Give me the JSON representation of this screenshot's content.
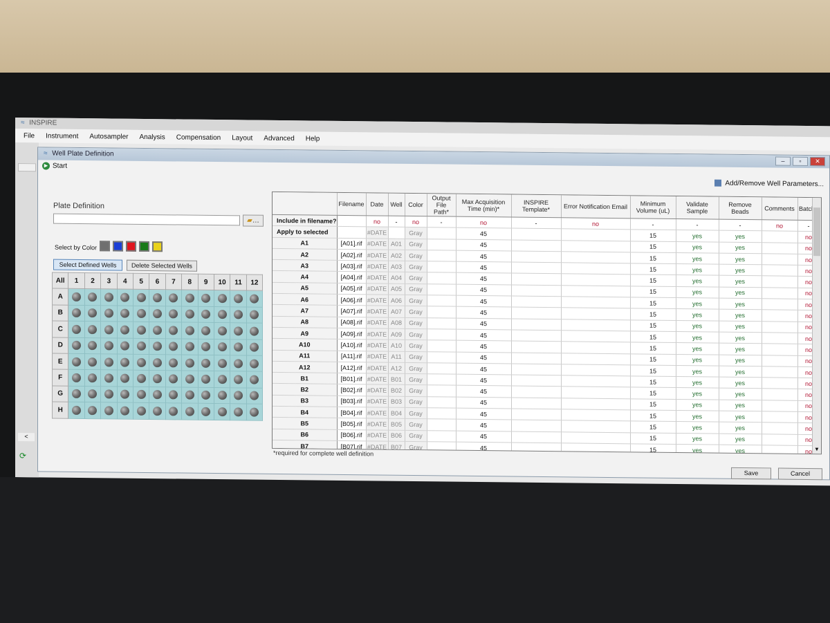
{
  "app": {
    "title": "INSPIRE",
    "menu": [
      "File",
      "Instrument",
      "Autosampler",
      "Analysis",
      "Compensation",
      "Layout",
      "Advanced",
      "Help"
    ]
  },
  "dialog": {
    "title": "Well Plate Definition",
    "start_label": "Start",
    "add_remove_label": "Add/Remove Well Parameters...",
    "plate_definition_label": "Plate Definition",
    "plate_definition_value": "",
    "folder_button": "…",
    "select_by_color_label": "Select by Color",
    "colors": [
      "#6f6f6f",
      "#1b3fd6",
      "#e0141e",
      "#1a7a1a",
      "#e9d21b"
    ],
    "select_defined_wells": "Select Defined Wells",
    "delete_selected_wells": "Delete Selected Wells",
    "save_label": "Save",
    "cancel_label": "Cancel",
    "footnote": "*required for complete well definition"
  },
  "plate": {
    "all_label": "All",
    "columns": [
      "1",
      "2",
      "3",
      "4",
      "5",
      "6",
      "7",
      "8",
      "9",
      "10",
      "11",
      "12"
    ],
    "rows": [
      "A",
      "B",
      "C",
      "D",
      "E",
      "F",
      "G",
      "H"
    ]
  },
  "grid": {
    "headers": [
      "",
      "Filename",
      "Date",
      "Well",
      "Color",
      "Output File Path*",
      "Max Acquisition Time (min)*",
      "INSPIRE Template*",
      "Error Notification Email",
      "Minimum Volume (uL)",
      "Validate Sample",
      "Remove Beads",
      "Comments",
      "Batch?"
    ],
    "include_row": {
      "label": "Include in filename?",
      "cells": [
        "",
        "no",
        "-",
        "no",
        "-",
        "no",
        "-",
        "no",
        "-",
        "-",
        "-",
        "no",
        "-"
      ]
    },
    "apply_row": {
      "label": "Apply to selected",
      "cells": [
        "",
        "#DATE",
        "",
        "Gray",
        "",
        "45",
        "",
        "",
        "15",
        "yes",
        "yes",
        "",
        "no"
      ]
    },
    "rows": [
      {
        "well": "A1",
        "filename": "[A01].rif",
        "date": "#DATE",
        "w": "A01",
        "color": "Gray",
        "time": "45",
        "vol": "15",
        "validate": "yes",
        "beads": "yes",
        "batch": "no"
      },
      {
        "well": "A2",
        "filename": "[A02].rif",
        "date": "#DATE",
        "w": "A02",
        "color": "Gray",
        "time": "45",
        "vol": "15",
        "validate": "yes",
        "beads": "yes",
        "batch": "no"
      },
      {
        "well": "A3",
        "filename": "[A03].rif",
        "date": "#DATE",
        "w": "A03",
        "color": "Gray",
        "time": "45",
        "vol": "15",
        "validate": "yes",
        "beads": "yes",
        "batch": "no"
      },
      {
        "well": "A4",
        "filename": "[A04].rif",
        "date": "#DATE",
        "w": "A04",
        "color": "Gray",
        "time": "45",
        "vol": "15",
        "validate": "yes",
        "beads": "yes",
        "batch": "no"
      },
      {
        "well": "A5",
        "filename": "[A05].rif",
        "date": "#DATE",
        "w": "A05",
        "color": "Gray",
        "time": "45",
        "vol": "15",
        "validate": "yes",
        "beads": "yes",
        "batch": "no"
      },
      {
        "well": "A6",
        "filename": "[A06].rif",
        "date": "#DATE",
        "w": "A06",
        "color": "Gray",
        "time": "45",
        "vol": "15",
        "validate": "yes",
        "beads": "yes",
        "batch": "no"
      },
      {
        "well": "A7",
        "filename": "[A07].rif",
        "date": "#DATE",
        "w": "A07",
        "color": "Gray",
        "time": "45",
        "vol": "15",
        "validate": "yes",
        "beads": "yes",
        "batch": "no"
      },
      {
        "well": "A8",
        "filename": "[A08].rif",
        "date": "#DATE",
        "w": "A08",
        "color": "Gray",
        "time": "45",
        "vol": "15",
        "validate": "yes",
        "beads": "yes",
        "batch": "no"
      },
      {
        "well": "A9",
        "filename": "[A09].rif",
        "date": "#DATE",
        "w": "A09",
        "color": "Gray",
        "time": "45",
        "vol": "15",
        "validate": "yes",
        "beads": "yes",
        "batch": "no"
      },
      {
        "well": "A10",
        "filename": "[A10].rif",
        "date": "#DATE",
        "w": "A10",
        "color": "Gray",
        "time": "45",
        "vol": "15",
        "validate": "yes",
        "beads": "yes",
        "batch": "no"
      },
      {
        "well": "A11",
        "filename": "[A11].rif",
        "date": "#DATE",
        "w": "A11",
        "color": "Gray",
        "time": "45",
        "vol": "15",
        "validate": "yes",
        "beads": "yes",
        "batch": "no"
      },
      {
        "well": "A12",
        "filename": "[A12].rif",
        "date": "#DATE",
        "w": "A12",
        "color": "Gray",
        "time": "45",
        "vol": "15",
        "validate": "yes",
        "beads": "yes",
        "batch": "no"
      },
      {
        "well": "B1",
        "filename": "[B01].rif",
        "date": "#DATE",
        "w": "B01",
        "color": "Gray",
        "time": "45",
        "vol": "15",
        "validate": "yes",
        "beads": "yes",
        "batch": "no"
      },
      {
        "well": "B2",
        "filename": "[B02].rif",
        "date": "#DATE",
        "w": "B02",
        "color": "Gray",
        "time": "45",
        "vol": "15",
        "validate": "yes",
        "beads": "yes",
        "batch": "no"
      },
      {
        "well": "B3",
        "filename": "[B03].rif",
        "date": "#DATE",
        "w": "B03",
        "color": "Gray",
        "time": "45",
        "vol": "15",
        "validate": "yes",
        "beads": "yes",
        "batch": "no"
      },
      {
        "well": "B4",
        "filename": "[B04].rif",
        "date": "#DATE",
        "w": "B04",
        "color": "Gray",
        "time": "45",
        "vol": "15",
        "validate": "yes",
        "beads": "yes",
        "batch": "no"
      },
      {
        "well": "B5",
        "filename": "[B05].rif",
        "date": "#DATE",
        "w": "B05",
        "color": "Gray",
        "time": "45",
        "vol": "15",
        "validate": "yes",
        "beads": "yes",
        "batch": "no"
      },
      {
        "well": "B6",
        "filename": "[B06].rif",
        "date": "#DATE",
        "w": "B06",
        "color": "Gray",
        "time": "45",
        "vol": "15",
        "validate": "yes",
        "beads": "yes",
        "batch": "no"
      },
      {
        "well": "B7",
        "filename": "[B07].rif",
        "date": "#DATE",
        "w": "B07",
        "color": "Gray",
        "time": "45",
        "vol": "15",
        "validate": "yes",
        "beads": "yes",
        "batch": "no"
      }
    ]
  }
}
